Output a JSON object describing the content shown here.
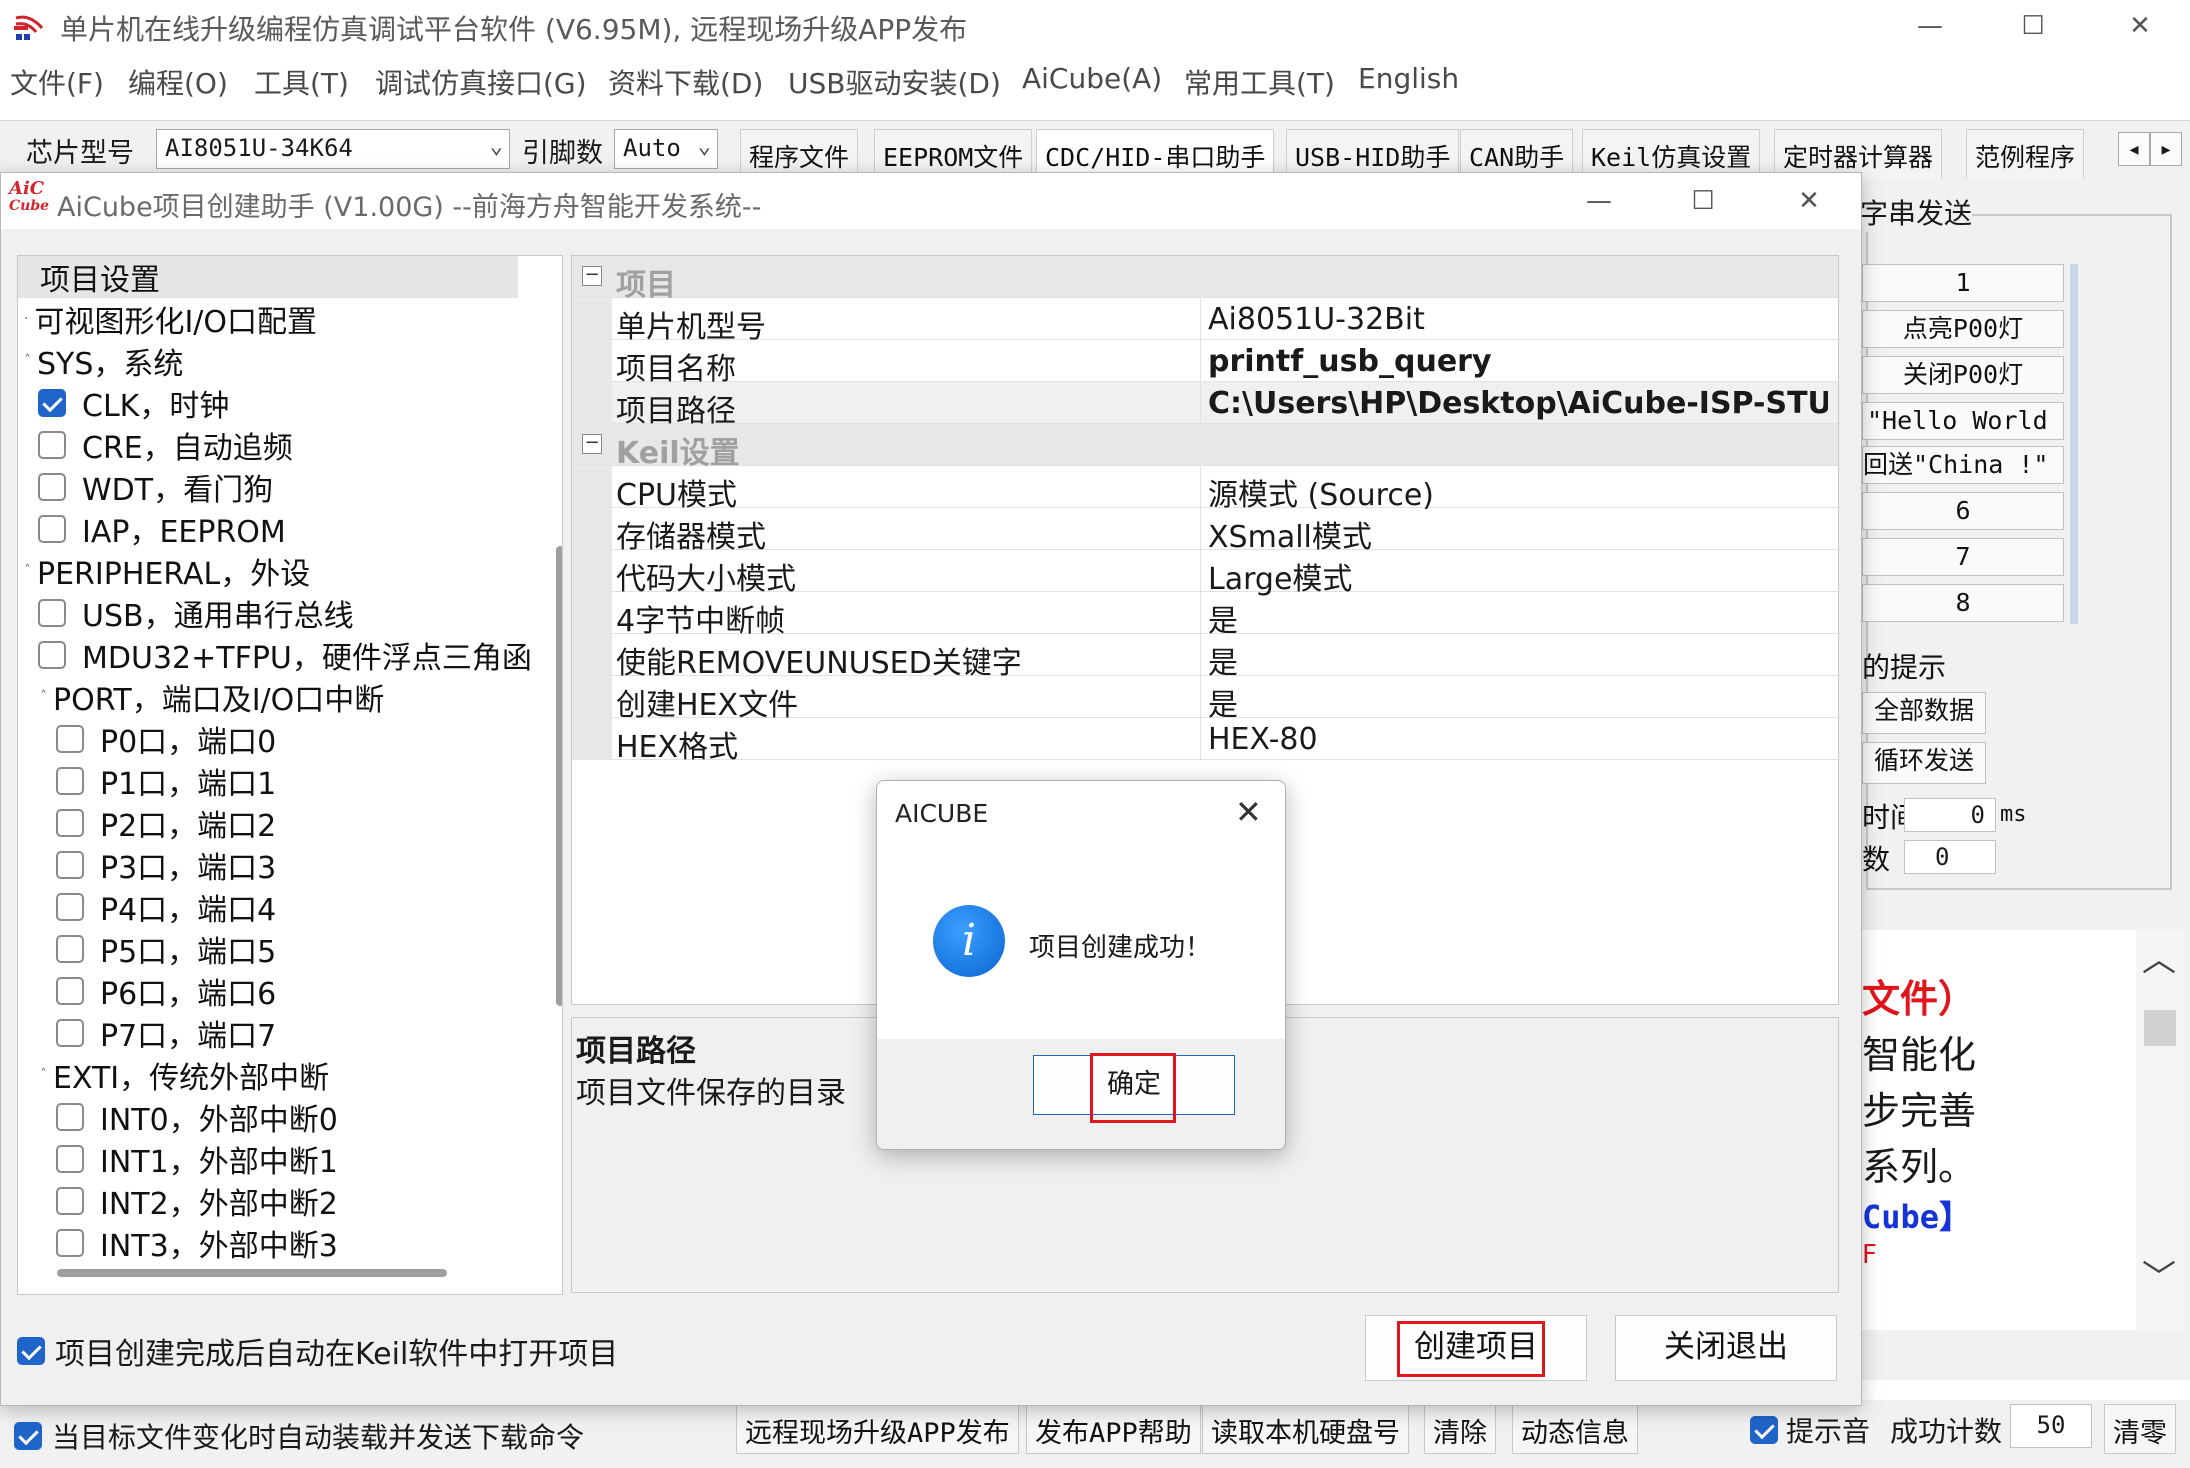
{
  "main": {
    "title": "单片机在线升级编程仿真调试平台软件 (V6.95M), 远程现场升级APP发布",
    "window_controls": {
      "minimize": "—",
      "maximize": "☐",
      "close": "✕"
    },
    "menu": [
      "文件(F)",
      "编程(O)",
      "工具(T)",
      "调试仿真接口(G)",
      "资料下载(D)",
      "USB驱动安装(D)",
      "AiCube(A)",
      "常用工具(T)",
      "English"
    ],
    "toolbar": {
      "chip_label": "芯片型号",
      "chip_value": "AI8051U-34K64",
      "pin_label": "引脚数",
      "pin_value": "Auto",
      "tabs": [
        "程序文件",
        "EEPROM文件",
        "CDC/HID-串口助手",
        "USB-HID助手",
        "CAN助手",
        "Keil仿真设置",
        "定时器计算器",
        "范例程序"
      ],
      "active_tab": "CDC/HID-串口助手"
    },
    "right_panel": {
      "group_title": "字串发送",
      "buttons": [
        "1",
        "点亮P00灯",
        "关闭P00灯",
        "\"Hello World !\"",
        "回送\"China !\"",
        "6",
        "7",
        "8"
      ],
      "hint_label": "的提示",
      "btn_all_data": "全部数据",
      "btn_loop_send": "循环发送",
      "interval_label": "时间",
      "interval_value": "0",
      "interval_unit": "ms",
      "count_label": "数",
      "count_value": "0",
      "log_lines": [
        {
          "text": "文件）",
          "color": "red"
        },
        {
          "text": "智能化",
          "color": "black"
        },
        {
          "text": "步完善",
          "color": "black"
        },
        {
          "text": "系列。",
          "color": "black"
        },
        {
          "text": "Cube】",
          "color": "blue"
        },
        {
          "text": "F",
          "color": "red"
        }
      ]
    },
    "status_bar": {
      "auto_load_label": "当目标文件变化时自动装载并发送下载命令",
      "btn_publish": "远程现场升级APP发布",
      "btn_publish_help": "发布APP帮助",
      "btn_read_disk": "读取本机硬盘号",
      "btn_clear": "清除",
      "btn_dynamic": "动态信息",
      "sound_label": "提示音",
      "success_label": "成功计数",
      "success_value": "50",
      "btn_clear2": "清零"
    }
  },
  "aicube": {
    "logo_top": "AiC",
    "logo_bottom": "Cube",
    "title": "AiCube项目创建助手 (V1.00G) --前海方舟智能开发系统--",
    "tree": [
      {
        "label": "项目设置",
        "level": 0,
        "type": "header",
        "selected": true
      },
      {
        "label": "可视图形化I/O口配置",
        "level": 0,
        "type": "node"
      },
      {
        "label": "SYS，系统",
        "level": 0,
        "type": "node"
      },
      {
        "label": "CLK，时钟",
        "level": 1,
        "type": "check",
        "checked": true
      },
      {
        "label": "CRE，自动追频",
        "level": 1,
        "type": "check",
        "checked": false
      },
      {
        "label": "WDT，看门狗",
        "level": 1,
        "type": "check",
        "checked": false
      },
      {
        "label": "IAP，EEPROM",
        "level": 1,
        "type": "check",
        "checked": false
      },
      {
        "label": "PERIPHERAL，外设",
        "level": 0,
        "type": "node"
      },
      {
        "label": "USB，通用串行总线",
        "level": 1,
        "type": "check",
        "checked": false
      },
      {
        "label": "MDU32+TFPU，硬件浮点三角函",
        "level": 1,
        "type": "check",
        "checked": false
      },
      {
        "label": "PORT，端口及I/O口中断",
        "level": 1,
        "type": "node"
      },
      {
        "label": "P0口，端口0",
        "level": 2,
        "type": "check",
        "checked": false
      },
      {
        "label": "P1口，端口1",
        "level": 2,
        "type": "check",
        "checked": false
      },
      {
        "label": "P2口，端口2",
        "level": 2,
        "type": "check",
        "checked": false
      },
      {
        "label": "P3口，端口3",
        "level": 2,
        "type": "check",
        "checked": false
      },
      {
        "label": "P4口，端口4",
        "level": 2,
        "type": "check",
        "checked": false
      },
      {
        "label": "P5口，端口5",
        "level": 2,
        "type": "check",
        "checked": false
      },
      {
        "label": "P6口，端口6",
        "level": 2,
        "type": "check",
        "checked": false
      },
      {
        "label": "P7口，端口7",
        "level": 2,
        "type": "check",
        "checked": false
      },
      {
        "label": "EXTI，传统外部中断",
        "level": 1,
        "type": "node"
      },
      {
        "label": "INT0，外部中断0",
        "level": 2,
        "type": "check",
        "checked": false
      },
      {
        "label": "INT1，外部中断1",
        "level": 2,
        "type": "check",
        "checked": false
      },
      {
        "label": "INT2，外部中断2",
        "level": 2,
        "type": "check",
        "checked": false
      },
      {
        "label": "INT3，外部中断3",
        "level": 2,
        "type": "check",
        "checked": false
      }
    ],
    "grid": {
      "categories": [
        {
          "name": "项目",
          "rows": [
            {
              "key": "单片机型号",
              "value": "Ai8051U-32Bit",
              "bold": false
            },
            {
              "key": "项目名称",
              "value": "printf_usb_query",
              "bold": true
            },
            {
              "key": "项目路径",
              "value": "C:\\Users\\HP\\Desktop\\AiCube-ISP-STU... ...",
              "bold": true,
              "highlight": true
            }
          ]
        },
        {
          "name": "Keil设置",
          "rows": [
            {
              "key": "CPU模式",
              "value": "源模式 (Source)",
              "bold": false
            },
            {
              "key": "存储器模式",
              "value": "XSmall模式",
              "bold": false
            },
            {
              "key": "代码大小模式",
              "value": "Large模式",
              "bold": false
            },
            {
              "key": "4字节中断帧",
              "value": "是",
              "bold": false
            },
            {
              "key": "使能REMOVEUNUSED关键字",
              "value": "是",
              "bold": false
            },
            {
              "key": "创建HEX文件",
              "value": "是",
              "bold": false
            },
            {
              "key": "HEX格式",
              "value": "HEX-80",
              "bold": false
            }
          ]
        }
      ]
    },
    "description": {
      "title": "项目路径",
      "text": "项目文件保存的目录"
    },
    "auto_open_label": "项目创建完成后自动在Keil软件中打开项目",
    "btn_create": "创建项目",
    "btn_close": "关闭退出"
  },
  "message_box": {
    "title": "AICUBE",
    "text": "项目创建成功！",
    "ok": "确定"
  }
}
